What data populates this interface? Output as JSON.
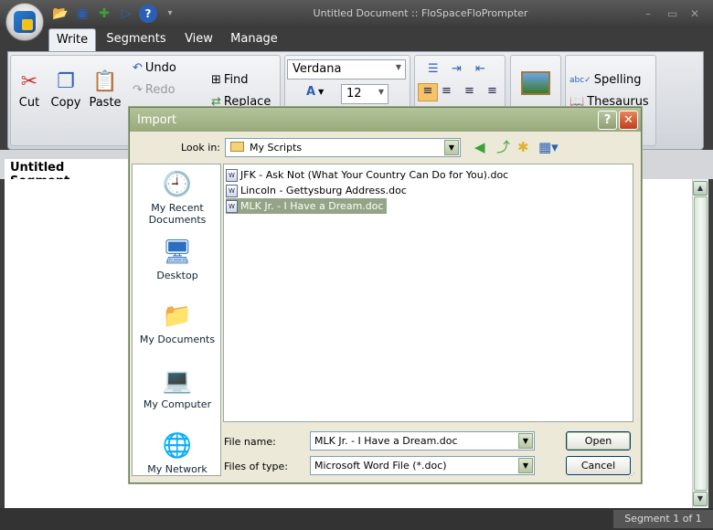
{
  "app": {
    "title": "Untitled Document :: FloSpaceFloPrompter"
  },
  "window_controls": {
    "minimize": "–",
    "restore": "▭",
    "close": "✕"
  },
  "qat": {
    "dropdown": "▾"
  },
  "tabs": [
    {
      "label": "Write",
      "active": true
    },
    {
      "label": "Segments",
      "active": false
    },
    {
      "label": "View",
      "active": false
    },
    {
      "label": "Manage",
      "active": false
    }
  ],
  "ribbon": {
    "cut": "Cut",
    "copy": "Copy",
    "paste": "Paste",
    "undo": "Undo",
    "redo": "Redo",
    "find": "Find",
    "replace": "Replace",
    "font": "Verdana",
    "font_size": "12",
    "spelling": "Spelling",
    "thesaurus": "Thesaurus"
  },
  "segment_tab": "Untitled Segment",
  "status": {
    "segment_count": "Segment 1 of 1"
  },
  "dialog": {
    "title": "Import",
    "help": "?",
    "close": "✕",
    "look_in_label": "Look in:",
    "look_in_value": "My Scripts",
    "places": [
      "My Recent Documents",
      "Desktop",
      "My Documents",
      "My Computer",
      "My Network"
    ],
    "files": [
      "JFK - Ask Not (What Your Country Can Do for You).doc",
      "Lincoln - Gettysburg Address.doc",
      "MLK Jr. - I Have a Dream.doc"
    ],
    "selected_file_index": 2,
    "file_name_label": "File name:",
    "file_name_value": "MLK Jr. - I Have a Dream.doc",
    "file_type_label": "Files of type:",
    "file_type_value": "Microsoft Word File (*.doc)",
    "open": "Open",
    "cancel": "Cancel"
  },
  "colors": {
    "selection": "#94a486",
    "dialog_title": "#a4b58a",
    "ribbon": "#dfe2e7"
  }
}
